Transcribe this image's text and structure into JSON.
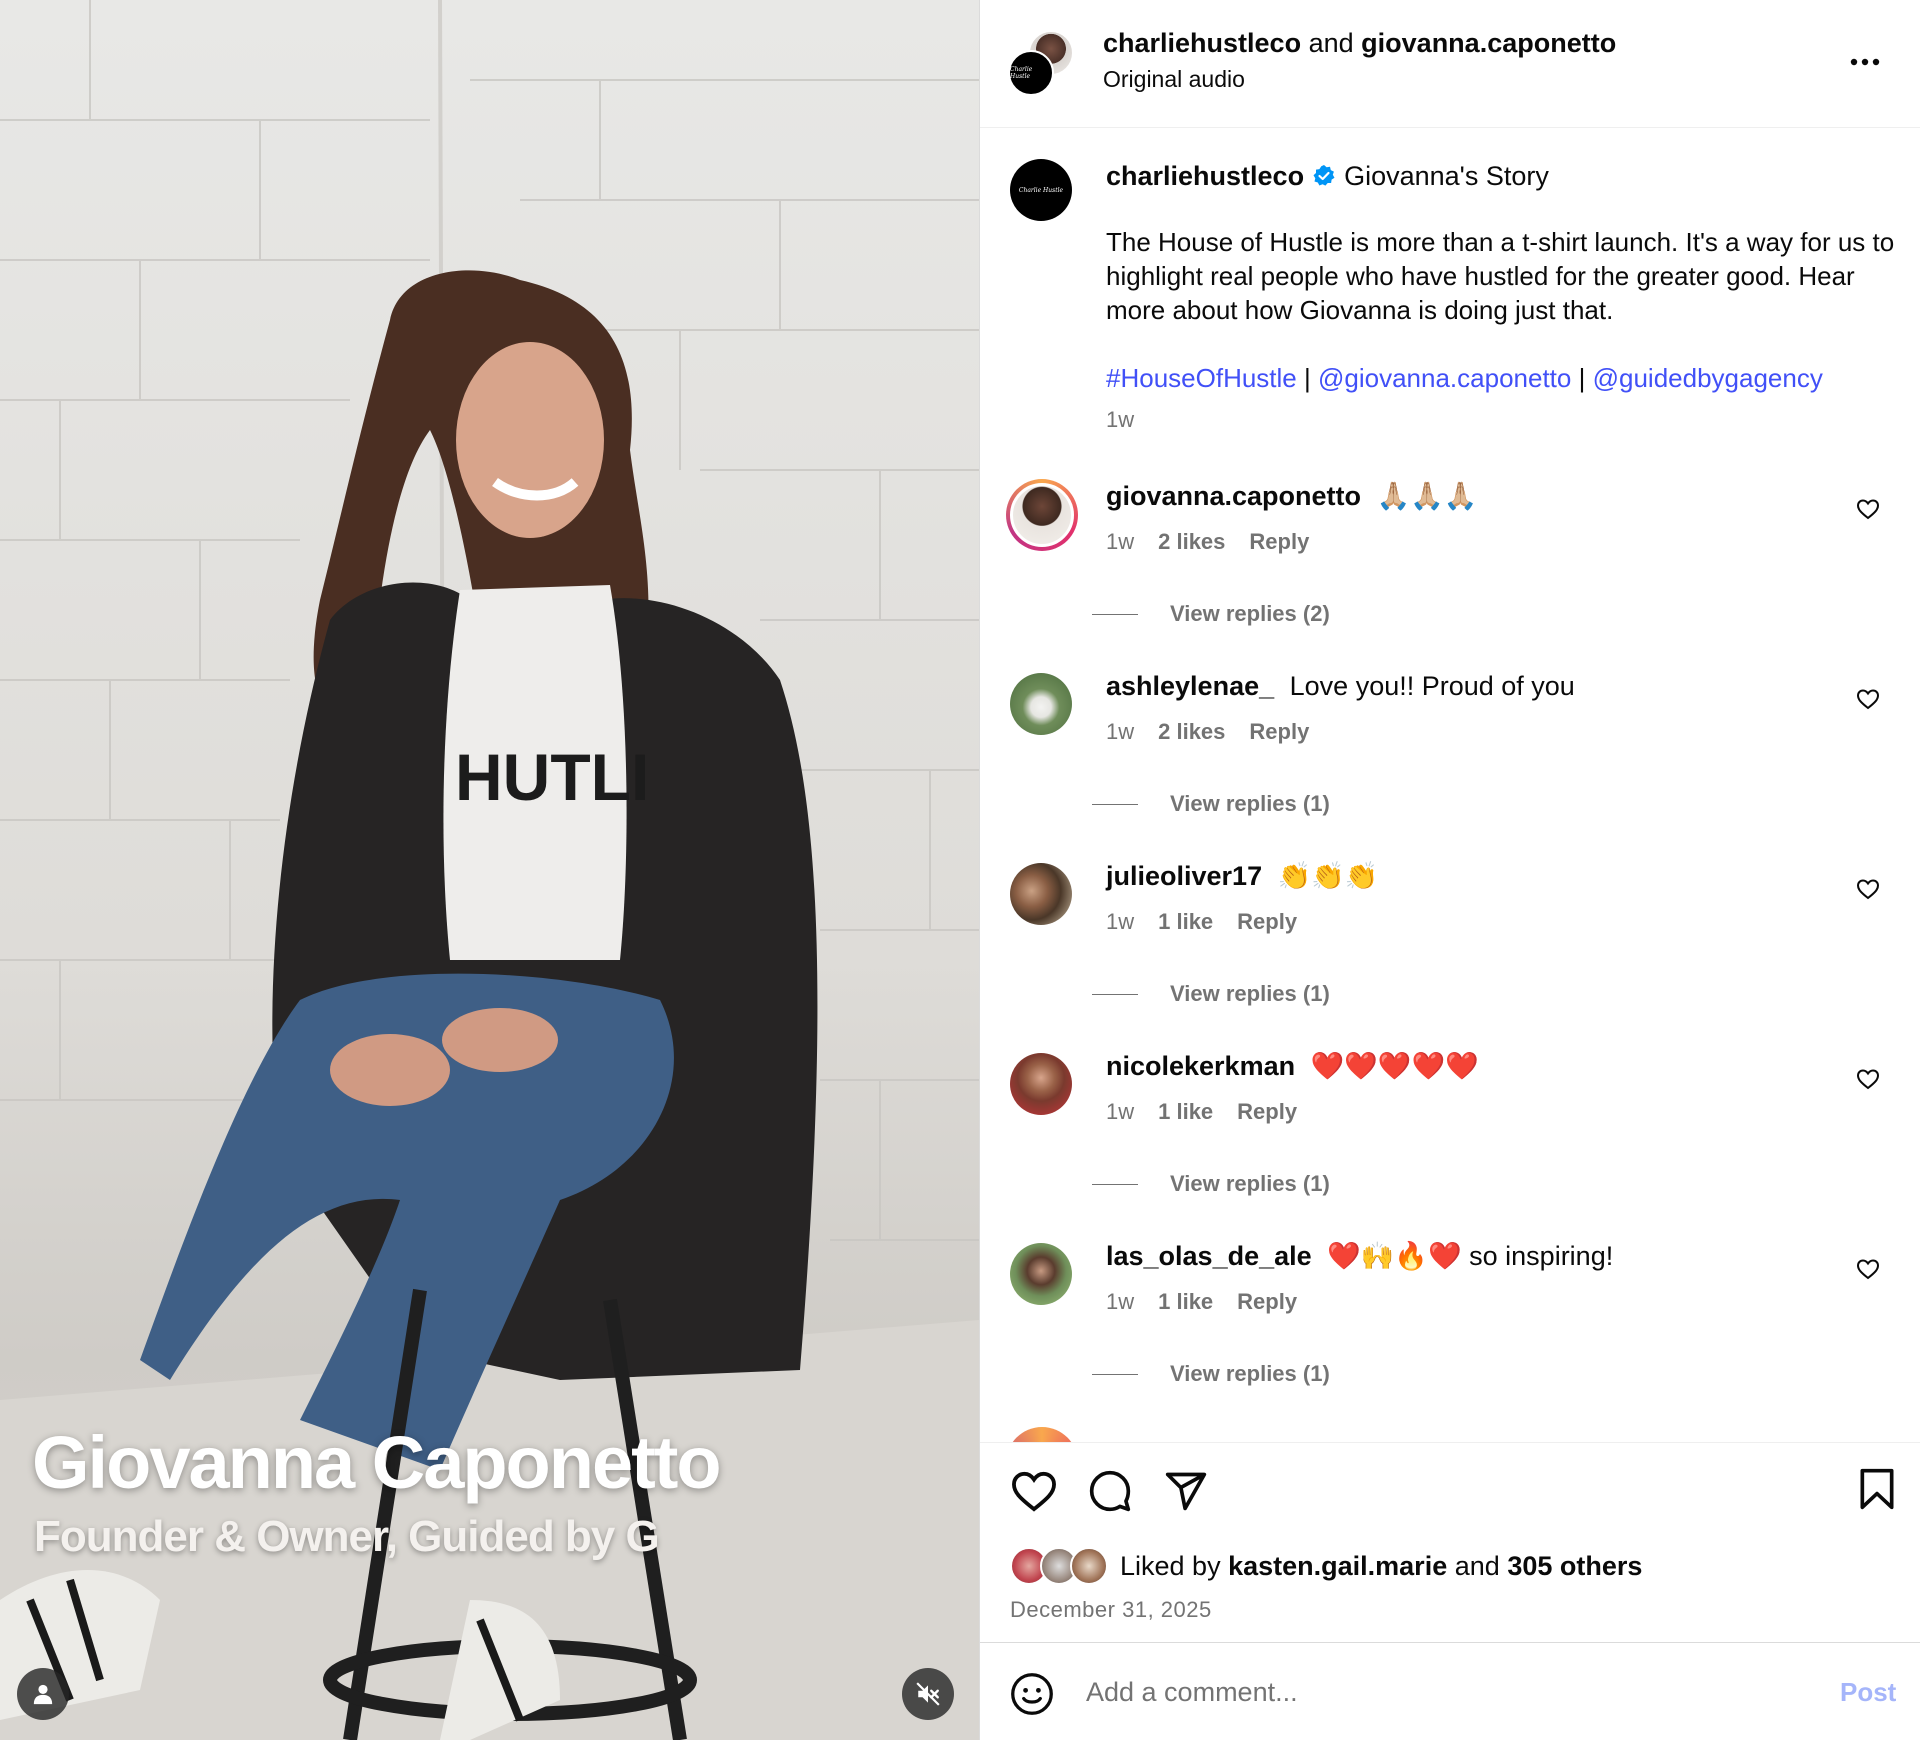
{
  "video": {
    "overlay_name": "Giovanna Caponetto",
    "overlay_title": "Founder & Owner, Guided by G",
    "shirt_text": "HUTLI"
  },
  "header": {
    "user1": "charliehustleco",
    "connector": "and",
    "user2": "giovanna.caponetto",
    "audio": "Original audio"
  },
  "caption": {
    "username": "charliehustleco",
    "title": "Giovanna's Story",
    "body": "The House of Hustle is more than a t-shirt launch. It's a way for us to highlight real people who have hustled for the greater good. Hear more about how Giovanna is doing just that.",
    "tags": [
      "#HouseOfHustle",
      "@giovanna.caponetto",
      "@guidedbygagency"
    ],
    "separator": "|",
    "time": "1w"
  },
  "comments": [
    {
      "user": "giovanna.caponetto",
      "text": "🙏🏼🙏🏼🙏🏼",
      "time": "1w",
      "likes": "2 likes",
      "reply": "Reply",
      "view_replies": "View replies (2)"
    },
    {
      "user": "ashleylenae_",
      "text": "Love you!! Proud of you",
      "time": "1w",
      "likes": "2 likes",
      "reply": "Reply",
      "view_replies": "View replies (1)"
    },
    {
      "user": "julieoliver17",
      "text": "👏👏👏",
      "time": "1w",
      "likes": "1 like",
      "reply": "Reply",
      "view_replies": "View replies (1)"
    },
    {
      "user": "nicolekerkman",
      "text": "❤️❤️❤️❤️❤️",
      "time": "1w",
      "likes": "1 like",
      "reply": "Reply",
      "view_replies": "View replies (1)"
    },
    {
      "user": "las_olas_de_ale",
      "text": "❤️🙌🔥❤️ so inspiring!",
      "time": "1w",
      "likes": "1 like",
      "reply": "Reply",
      "view_replies": "View replies (1)"
    }
  ],
  "likes": {
    "prefix": "Liked by",
    "user": "kasten.gail.marie",
    "connector": "and",
    "others": "305 others",
    "date": "December 31, 2025"
  },
  "comment_box": {
    "placeholder": "Add a comment...",
    "post_label": "Post"
  },
  "colors": {
    "link": "#4150f7",
    "muted": "#737373",
    "verified": "#0095f6",
    "post_disabled": "#a5b5fa"
  },
  "icons": {
    "header_more": "more-horizontal-icon",
    "verified": "verified-badge-icon",
    "comment_like": "heart-outline-icon",
    "actions": [
      "heart-icon",
      "comment-icon",
      "share-icon",
      "bookmark-icon"
    ],
    "emoji": "emoji-icon",
    "mute": "speaker-muted-icon",
    "user_tag": "user-icon"
  }
}
